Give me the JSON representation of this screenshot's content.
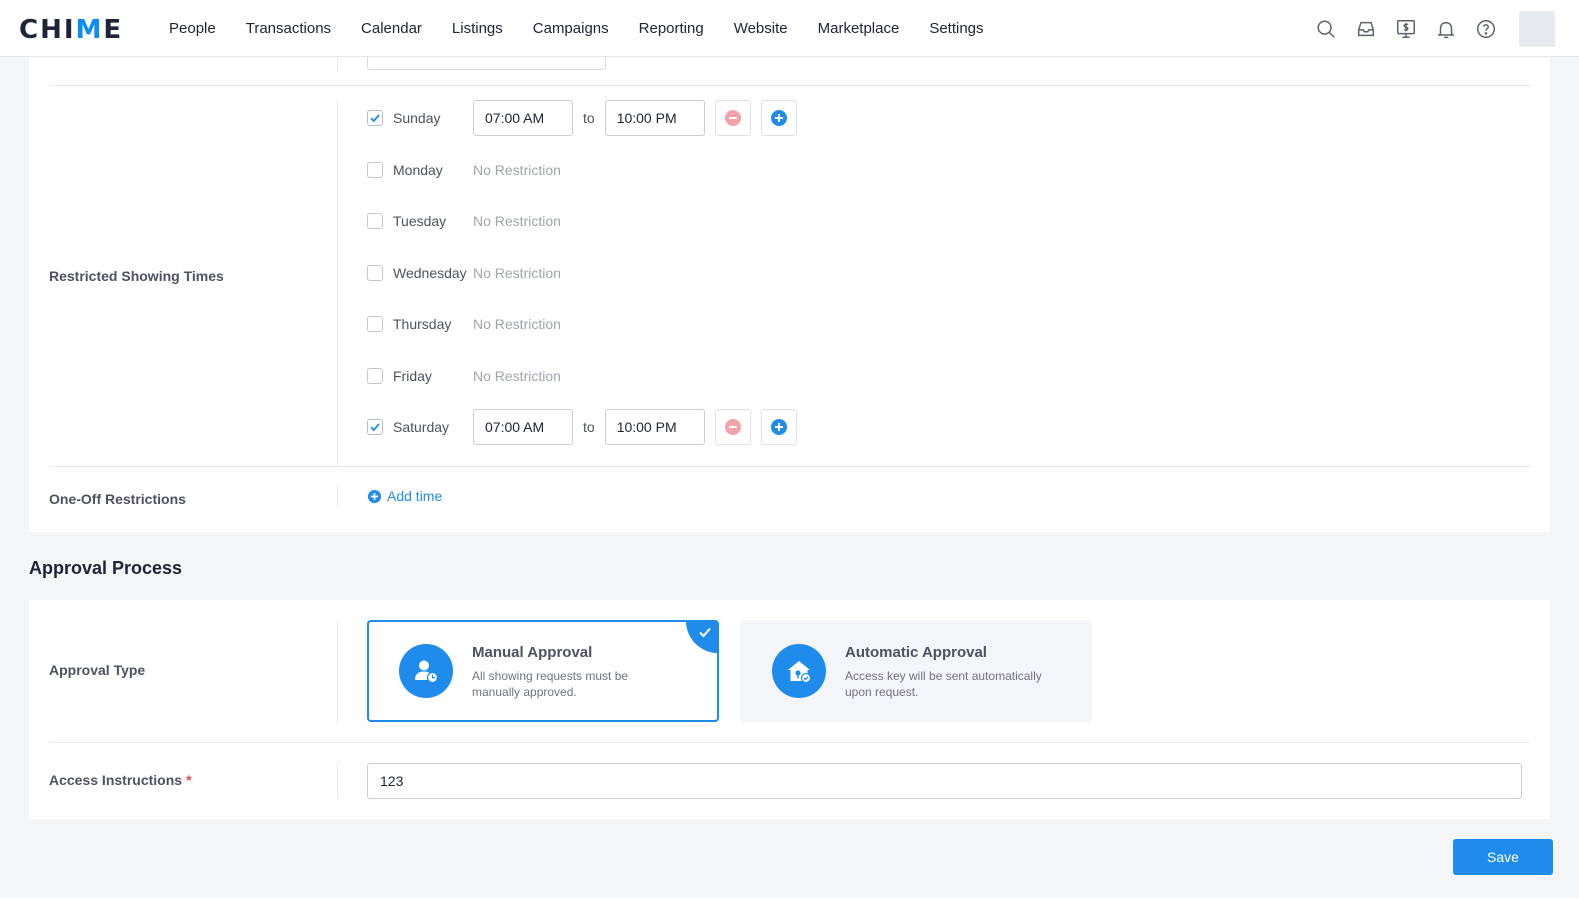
{
  "brand": {
    "name_prefix": "CHI",
    "name_mark": "M",
    "name_suffix": "E"
  },
  "nav": {
    "items": [
      "People",
      "Transactions",
      "Calendar",
      "Listings",
      "Campaigns",
      "Reporting",
      "Website",
      "Marketplace",
      "Settings"
    ],
    "icons": [
      "search-icon",
      "inbox-icon",
      "billing-icon",
      "bell-icon",
      "help-icon"
    ]
  },
  "restricted": {
    "label": "Restricted Showing Times",
    "days": [
      {
        "name": "Sunday",
        "checked": true,
        "from": "07:00 AM",
        "to": "10:00 PM"
      },
      {
        "name": "Monday",
        "checked": false,
        "status": "No Restriction"
      },
      {
        "name": "Tuesday",
        "checked": false,
        "status": "No Restriction"
      },
      {
        "name": "Wednesday",
        "checked": false,
        "status": "No Restriction"
      },
      {
        "name": "Thursday",
        "checked": false,
        "status": "No Restriction"
      },
      {
        "name": "Friday",
        "checked": false,
        "status": "No Restriction"
      },
      {
        "name": "Saturday",
        "checked": true,
        "from": "07:00 AM",
        "to": "10:00 PM"
      }
    ],
    "to_word": "to"
  },
  "one_off": {
    "label": "One-Off Restrictions",
    "add_label": "Add time"
  },
  "approval": {
    "section_title": "Approval Process",
    "type_label": "Approval Type",
    "options": [
      {
        "title": "Manual Approval",
        "desc": "All showing requests must be manually approved.",
        "selected": true
      },
      {
        "title": "Automatic Approval",
        "desc": "Access key will be sent automatically upon request.",
        "selected": false
      }
    ]
  },
  "access": {
    "label": "Access Instructions",
    "required_mark": "*",
    "value": "123"
  },
  "save_label": "Save",
  "colors": {
    "accent": "#1f8ceb",
    "remove": "#f3a3a8",
    "required": "#f0454c"
  }
}
